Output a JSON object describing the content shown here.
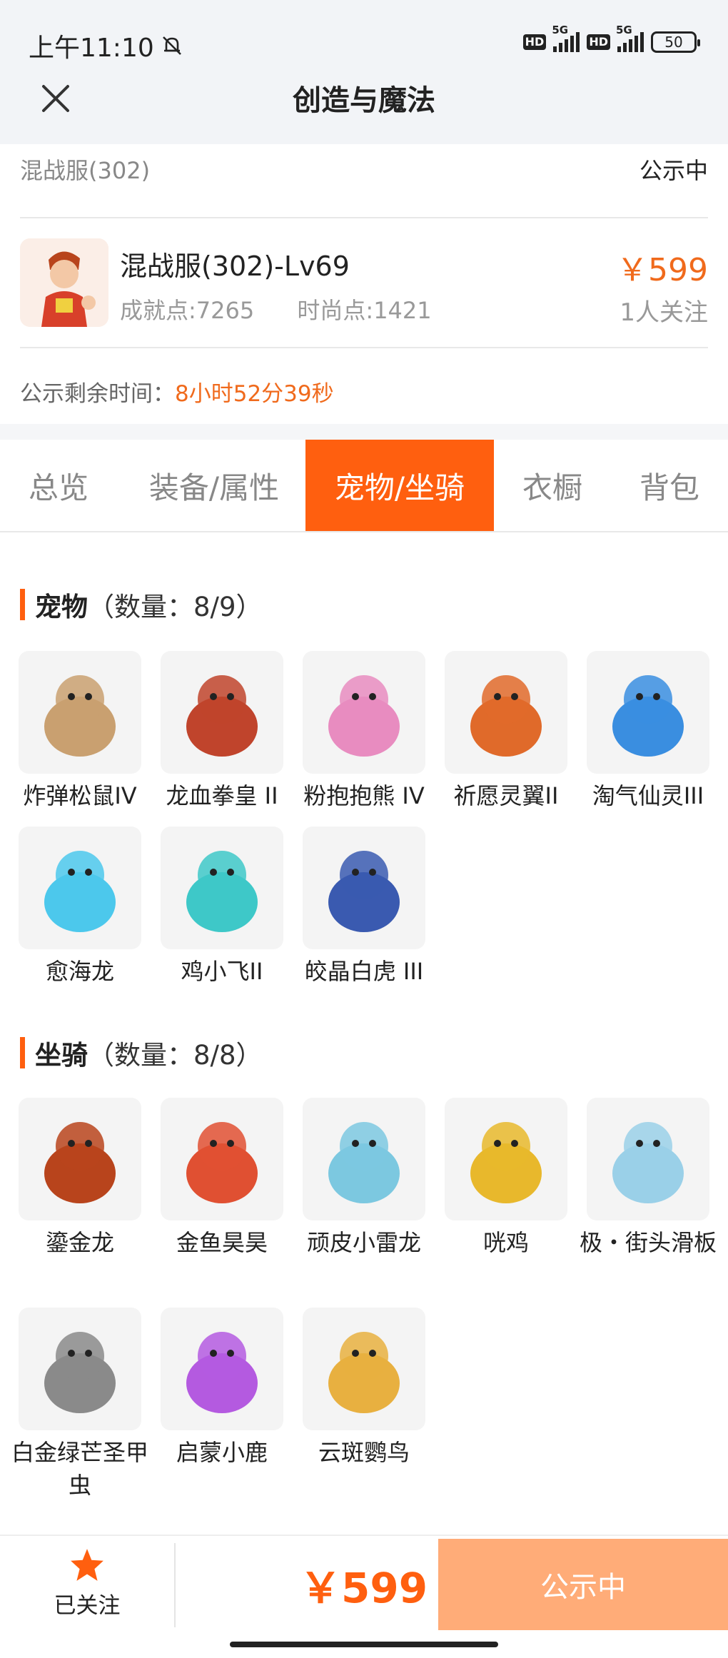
{
  "status_bar": {
    "time": "上午11:10",
    "hd1": "HD",
    "net1": "5G",
    "hd2": "HD",
    "net2": "5G",
    "battery": "50"
  },
  "header": {
    "title": "创造与魔法"
  },
  "server": {
    "name": "混战服(302)",
    "status": "公示中"
  },
  "character": {
    "name": "混战服(302)-Lv69",
    "achievement": "成就点:7265",
    "fashion": "时尚点:1421",
    "price": "￥599",
    "followers": "1人关注"
  },
  "countdown": {
    "label": "公示剩余时间：",
    "value": "8小时52分39秒"
  },
  "tabs": [
    {
      "label": "总览",
      "active": false
    },
    {
      "label": "装备/属性",
      "active": false
    },
    {
      "label": "宠物/坐骑",
      "active": true
    },
    {
      "label": "衣橱",
      "active": false
    },
    {
      "label": "背包",
      "active": false
    }
  ],
  "pets": {
    "title": "宠物",
    "count": "（数量：8/9）",
    "items": [
      {
        "label": "炸弹松鼠IV",
        "icon": "squirrel-icon",
        "color": "#c9a070"
      },
      {
        "label": "龙血拳皇 II",
        "icon": "dragon-boxer-icon",
        "color": "#c0442c"
      },
      {
        "label": "粉抱抱熊 IV",
        "icon": "pink-bear-icon",
        "color": "#e88cc0"
      },
      {
        "label": "祈愿灵翼II",
        "icon": "griffin-icon",
        "color": "#e06a2a"
      },
      {
        "label": "淘气仙灵III",
        "icon": "blue-pup-icon",
        "color": "#3a8ee0"
      },
      {
        "label": "愈海龙",
        "icon": "sea-dragon-icon",
        "color": "#4cc8ec"
      },
      {
        "label": "鸡小飞II",
        "icon": "chick-muscle-icon",
        "color": "#3ec8c8"
      },
      {
        "label": "皎晶白虎 III",
        "icon": "white-tiger-icon",
        "color": "#3a5ab0"
      }
    ]
  },
  "mounts": {
    "title": "坐骑",
    "count": "（数量：8/8）",
    "items": [
      {
        "label": "鎏金龙",
        "icon": "gold-dragon-icon",
        "color": "#b8441c"
      },
      {
        "label": "金鱼昊昊",
        "icon": "goldfish-icon",
        "color": "#e05032"
      },
      {
        "label": "顽皮小雷龙",
        "icon": "dino-icon",
        "color": "#7cc8e0"
      },
      {
        "label": "咣鸡",
        "icon": "rooster-icon",
        "color": "#e8b82c"
      },
      {
        "label": "极・街头滑板",
        "icon": "skateboard-icon",
        "color": "#9ad0e8"
      },
      {
        "label": "白金绿芒圣甲虫",
        "icon": "beetle-icon",
        "color": "#8a8a8a"
      },
      {
        "label": "启蒙小鹿",
        "icon": "deer-icon",
        "color": "#b45ae0"
      },
      {
        "label": "云斑鹦鸟",
        "icon": "parrot-icon",
        "color": "#e8b040"
      }
    ]
  },
  "bottom": {
    "fav_label": "已关注",
    "price": "￥599",
    "cta": "公示中"
  },
  "colors": {
    "accent": "#ff5f0f",
    "price": "#f06a1c",
    "cta_bg": "#ffac78"
  }
}
